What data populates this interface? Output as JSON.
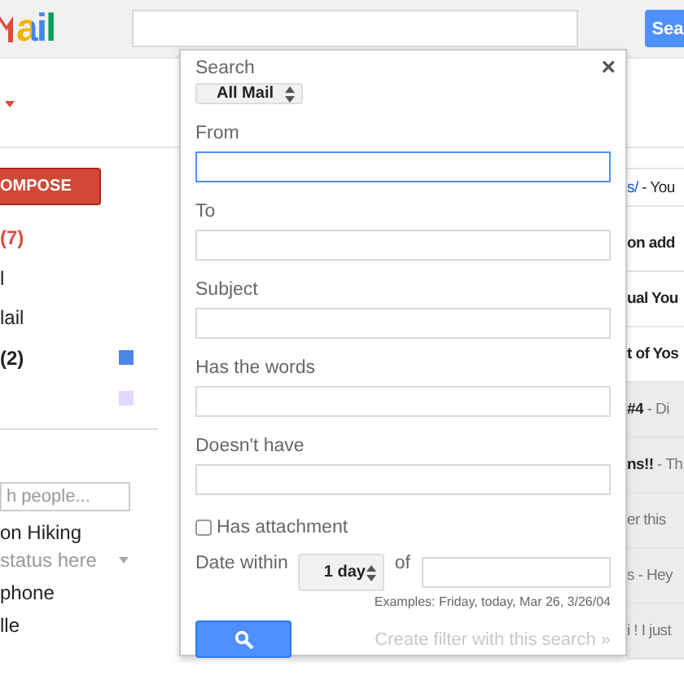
{
  "header": {
    "logo": "ail",
    "search_button": "Sea"
  },
  "compose": "OMPOSE",
  "labels": [
    {
      "text": "(7)",
      "selected": true,
      "bold": true
    },
    {
      "text": "l",
      "selected": false,
      "bold": false
    },
    {
      "text": "lail",
      "selected": false,
      "bold": false
    },
    {
      "text": "(2)",
      "selected": false,
      "bold": true,
      "color": "#4a86e8"
    },
    {
      "color": "#e3d7ff"
    }
  ],
  "people": {
    "placeholder": "h people...",
    "contacts": [
      {
        "name": "on Hiking",
        "status": "status here"
      },
      {
        "name": "phone"
      },
      {
        "name": "lle"
      }
    ]
  },
  "dialog": {
    "close": "×",
    "scope_label": "Search",
    "scope": "All Mail",
    "fields": [
      {
        "label": "From",
        "focused": true
      },
      {
        "label": "To",
        "focused": false
      },
      {
        "label": "Subject",
        "focused": false
      },
      {
        "label": "Has the words",
        "focused": false
      },
      {
        "label": "Doesn't have",
        "focused": false
      }
    ],
    "attachment": {
      "label": "Has attachment",
      "checked": false
    },
    "date": {
      "label": "Date within",
      "value": "1 day",
      "of": "of",
      "examples": "Examples: Friday, today, Mar 26, 3/26/04"
    },
    "create_filter": "Create filter with this search »"
  },
  "mails": [
    {
      "subject": "s/",
      "snippet": " - You",
      "kind": "link",
      "read": false
    },
    {
      "subject": "on add",
      "kind": "text",
      "read": false
    },
    {
      "subject": "ual You",
      "kind": "text",
      "read": false
    },
    {
      "subject": "t of Yos",
      "kind": "text",
      "read": false
    },
    {
      "subject": "#4",
      "snippet": " - Di",
      "kind": "text",
      "read": true
    },
    {
      "subject": "ns!!",
      "snippet": " - Th",
      "kind": "text",
      "read": true
    },
    {
      "snippet": "er this",
      "kind": "text",
      "read": true
    },
    {
      "snippet": "s - Hey",
      "kind": "text",
      "read": true
    },
    {
      "snippet": "i ! I just",
      "kind": "text",
      "read": true
    }
  ]
}
